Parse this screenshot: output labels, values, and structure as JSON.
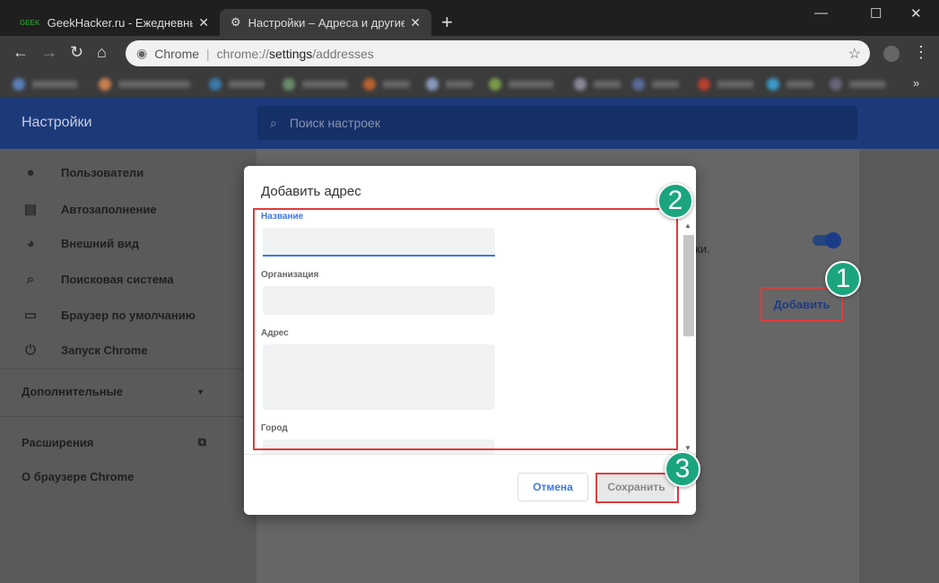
{
  "browser": {
    "tabs": [
      {
        "label": "GeekHacker.ru - Ежедневный журнал",
        "favicon": "GEEK"
      },
      {
        "label": "Настройки – Адреса и другие данные"
      }
    ],
    "omnibox": {
      "site": "Chrome",
      "url_prefix": "chrome://",
      "url_host": "settings",
      "url_path": "/addresses"
    }
  },
  "settings": {
    "title": "Настройки",
    "search_placeholder": "Поиск настроек",
    "sidebar": [
      {
        "label": "Пользователи",
        "icon": "person-icon"
      },
      {
        "label": "Автозаполнение",
        "icon": "clipboard-icon"
      },
      {
        "label": "Внешний вид",
        "icon": "palette-icon"
      },
      {
        "label": "Поисковая система",
        "icon": "search-icon"
      },
      {
        "label": "Браузер по умолчанию",
        "icon": "browser-icon"
      },
      {
        "label": "Запуск Chrome",
        "icon": "power-icon"
      }
    ],
    "advanced": "Дополнительные",
    "extensions": "Расширения",
    "about": "О браузере Chrome",
    "content_fragment": "ки.",
    "add_button": "Добавить"
  },
  "dialog": {
    "title": "Добавить адрес",
    "fields": [
      {
        "label": "Название",
        "value": ""
      },
      {
        "label": "Организация",
        "value": ""
      },
      {
        "label": "Адрес",
        "value": ""
      },
      {
        "label": "Город",
        "value": ""
      }
    ],
    "cancel": "Отмена",
    "save": "Сохранить"
  },
  "annotations": [
    "1",
    "2",
    "3"
  ]
}
